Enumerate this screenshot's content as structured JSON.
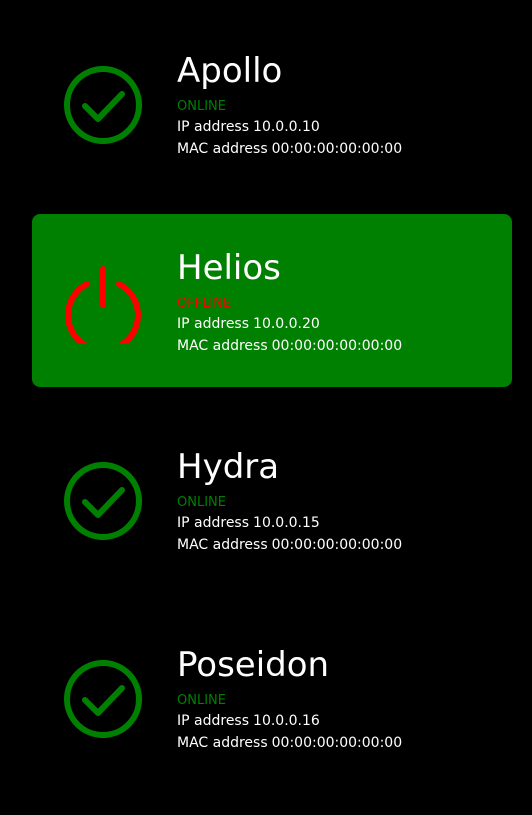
{
  "colors": {
    "background": "#000000",
    "selected_background": "#008000",
    "online": "#008000",
    "offline": "#ff0000",
    "text": "#ffffff"
  },
  "labels": {
    "ip": "IP address",
    "mac": "MAC address"
  },
  "devices": [
    {
      "name": "Apollo",
      "status": "ONLINE",
      "icon": "check-circle-icon",
      "ip": "10.0.0.10",
      "mac": "00:00:00:00:00:00",
      "selected": false
    },
    {
      "name": "Helios",
      "status": "OFFLINE",
      "icon": "power-icon",
      "ip": "10.0.0.20",
      "mac": "00:00:00:00:00:00",
      "selected": true
    },
    {
      "name": "Hydra",
      "status": "ONLINE",
      "icon": "check-circle-icon",
      "ip": "10.0.0.15",
      "mac": "00:00:00:00:00:00",
      "selected": false
    },
    {
      "name": "Poseidon",
      "status": "ONLINE",
      "icon": "check-circle-icon",
      "ip": "10.0.0.16",
      "mac": "00:00:00:00:00:00",
      "selected": false
    }
  ]
}
